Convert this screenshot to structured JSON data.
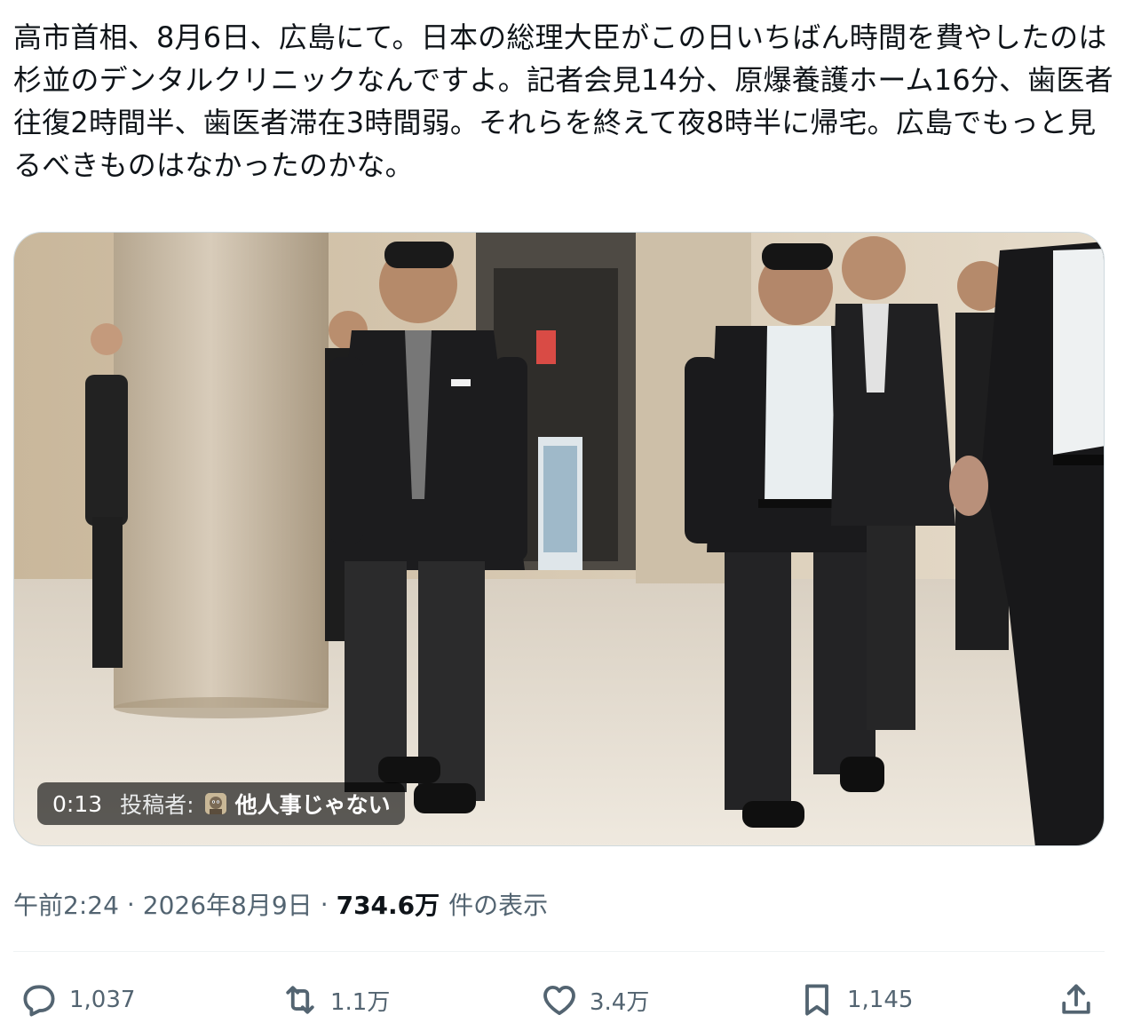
{
  "tweet": {
    "text": "高市首相、8月6日、広島にて。日本の総理大臣がこの日いちばん時間を費やしたのは杉並のデンタルクリニックなんですよ。記者会見14分、原爆養護ホーム16分、歯医者往復2時間半、歯医者滞在3時間弱。それらを終えて夜8時半に帰宅。広島でもっと見るべきものはなかったのかな。"
  },
  "video": {
    "time": "0:13",
    "poster_label": "投稿者:",
    "poster_name": "他人事じゃない"
  },
  "meta": {
    "time": "午前2:24",
    "separator": "·",
    "date": "2026年8月9日",
    "views": "734.6万",
    "views_label": "件の表示"
  },
  "actions": {
    "reply": {
      "icon": "reply-icon",
      "count": "1,037"
    },
    "retweet": {
      "icon": "retweet-icon",
      "count": "1.1万"
    },
    "like": {
      "icon": "heart-icon",
      "count": "3.4万"
    },
    "bookmark": {
      "icon": "bookmark-icon",
      "count": "1,145"
    },
    "share": {
      "icon": "share-icon"
    }
  },
  "colors": {
    "text": "#0f1419",
    "secondary": "#536471",
    "border": "#cfd9de"
  }
}
